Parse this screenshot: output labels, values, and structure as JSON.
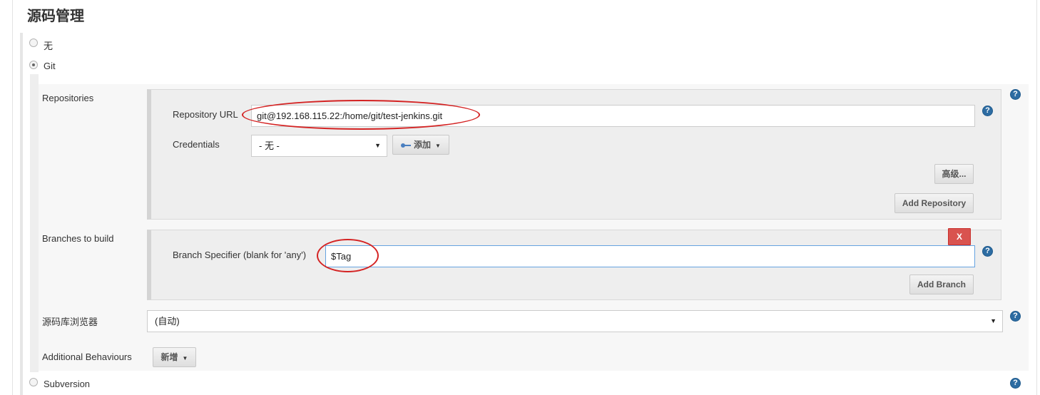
{
  "section": {
    "title": "源码管理"
  },
  "scm_options": {
    "none_label": "无",
    "git_label": "Git",
    "svn_label": "Subversion",
    "selected": "Git"
  },
  "git": {
    "repositories_label": "Repositories",
    "repo_url_label": "Repository URL",
    "repo_url_value": "git@192.168.115.22:/home/git/test-jenkins.git",
    "credentials_label": "Credentials",
    "credentials_value": "- 无 -",
    "add_credentials_label": "添加",
    "advanced_label": "高级...",
    "add_repository_label": "Add Repository",
    "branches_label": "Branches to build",
    "branch_specifier_label": "Branch Specifier (blank for 'any')",
    "branch_specifier_value": "$Tag",
    "delete_branch_label": "X",
    "add_branch_label": "Add Branch",
    "browser_label": "源码库浏览器",
    "browser_value": "(自动)",
    "additional_label": "Additional Behaviours",
    "additional_add_label": "新增"
  },
  "help_glyph": "?",
  "select_caret": "▼",
  "dropdown_caret": "▼",
  "colors": {
    "help": "#2d6ca2",
    "danger": "#d9534f",
    "highlight_ellipse": "#d42323"
  }
}
